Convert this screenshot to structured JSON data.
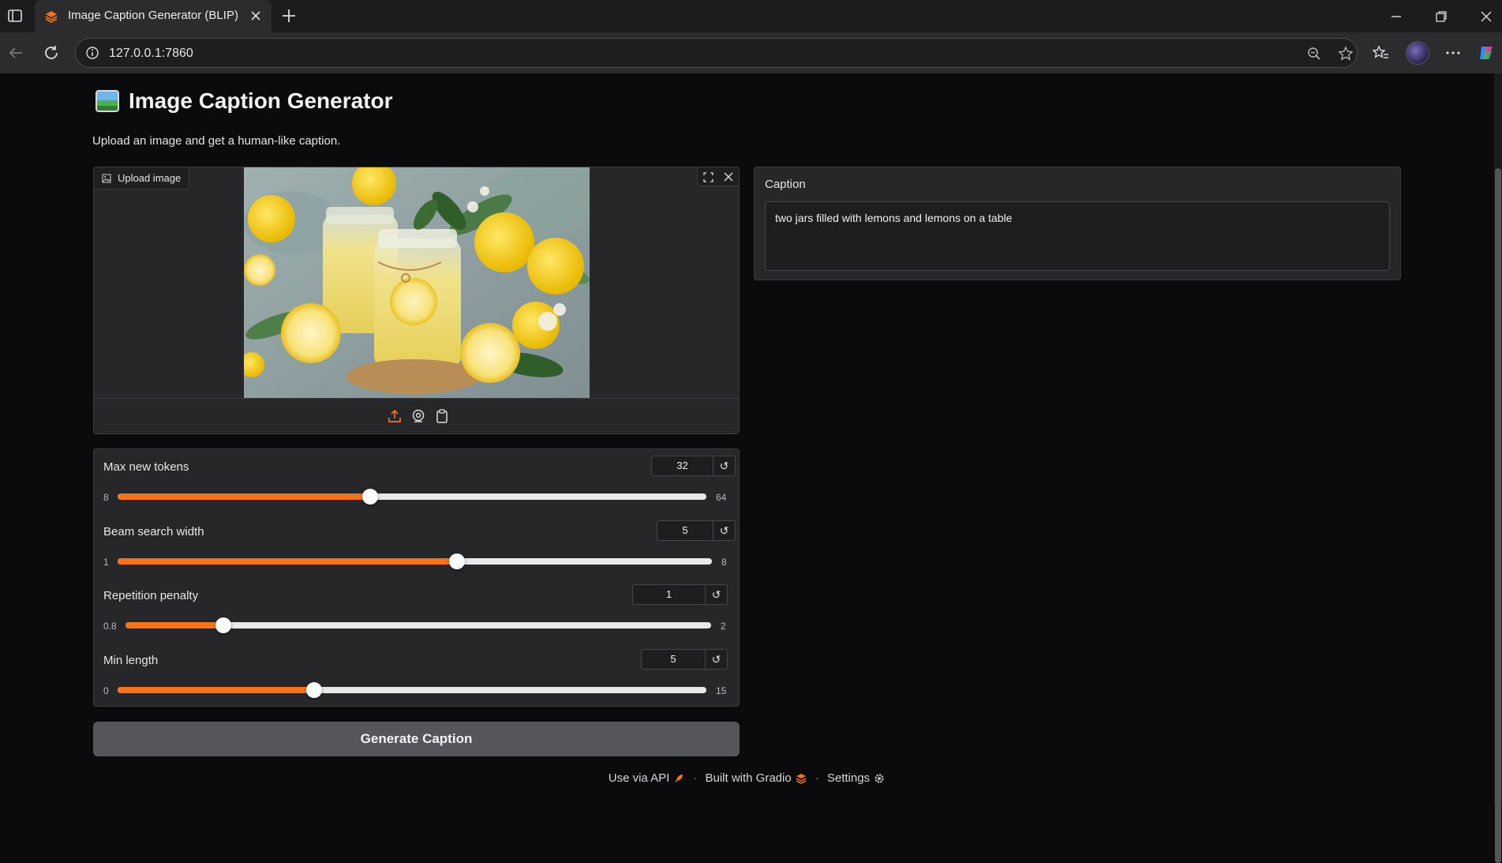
{
  "browser": {
    "tab_title": "Image Caption Generator (BLIP)",
    "url": "127.0.0.1:7860"
  },
  "app": {
    "title": "Image Caption Generator",
    "description": "Upload an image and get a human-like caption."
  },
  "image_input": {
    "label": "Upload image"
  },
  "sliders": [
    {
      "label": "Max new tokens",
      "value": "32",
      "min": "8",
      "max": "64",
      "fraction": 0.4286
    },
    {
      "label": "Beam search width",
      "value": "5",
      "min": "1",
      "max": "8",
      "fraction": 0.5714
    },
    {
      "label": "Repetition penalty",
      "value": "1",
      "min": "0.8",
      "max": "2",
      "fraction": 0.1667
    },
    {
      "label": "Min length",
      "value": "5",
      "min": "0",
      "max": "15",
      "fraction": 0.3333
    }
  ],
  "generate_button": "Generate Caption",
  "caption": {
    "label": "Caption",
    "text": "two jars filled with lemons and lemons on a table"
  },
  "footer": {
    "api": "Use via API",
    "built": "Built with Gradio",
    "settings": "Settings"
  },
  "colors": {
    "accent": "#f97316",
    "panel": "#27272a",
    "background": "#0b0b0d"
  }
}
